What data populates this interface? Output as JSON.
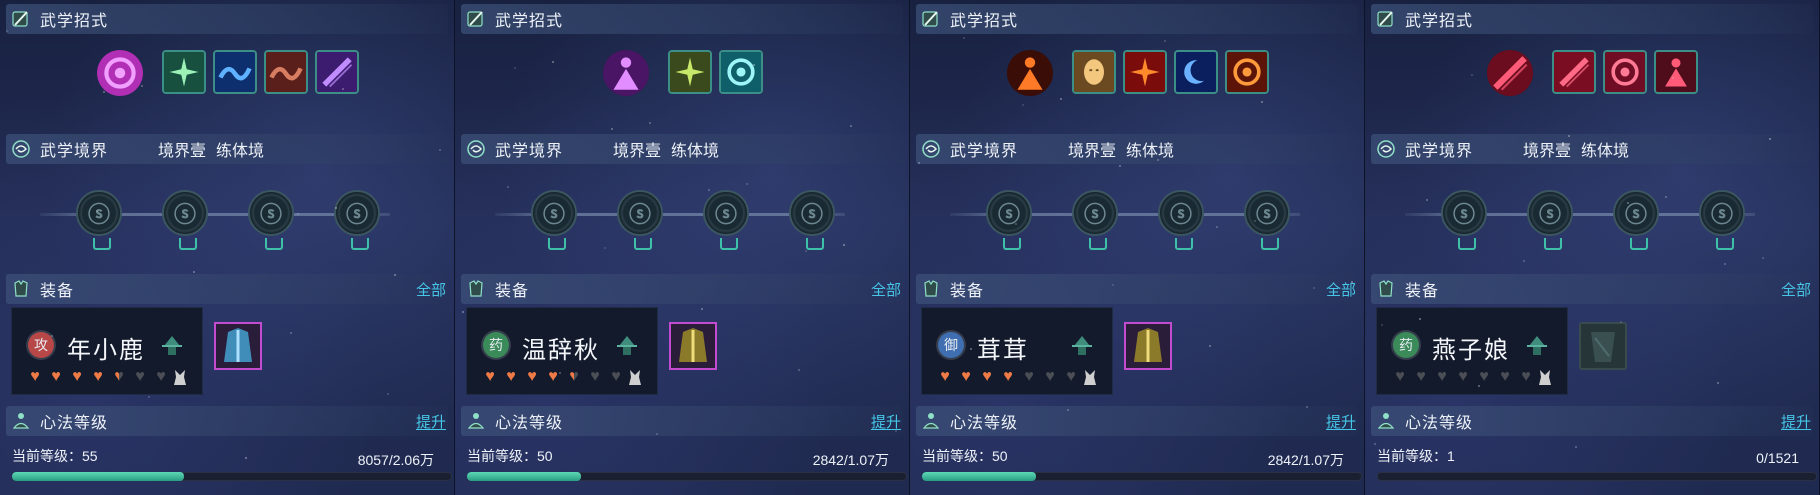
{
  "sections": {
    "moves_title": "武学招式",
    "realm_title": "武学境界",
    "equip_title": "装备",
    "equip_all": "全部",
    "xinfa_title": "心法等级",
    "xinfa_upgrade": "提升",
    "current_level_label": "当前等级："
  },
  "panels": [
    {
      "realm_level": "境界壹",
      "realm_name": "练体境",
      "character": {
        "badge": "攻",
        "badge_color": "#b84848",
        "name": "年小鹿",
        "stars": [
          1,
          1,
          1,
          1,
          0.5,
          0,
          0
        ]
      },
      "gear": "robe-blue",
      "level": "55",
      "exp": "8057/2.06万",
      "progress": 0.39,
      "skills": [
        "purple-vortex",
        "green-burst",
        "blue-serpent",
        "red-dragon",
        "violet-slash"
      ]
    },
    {
      "realm_level": "境界壹",
      "realm_name": "练体境",
      "character": {
        "badge": "药",
        "badge_color": "#3b8a5a",
        "name": "温辞秋",
        "stars": [
          1,
          1,
          1,
          1,
          0.5,
          0,
          0
        ]
      },
      "gear": "robe-gold",
      "level": "50",
      "exp": "2842/1.07万",
      "progress": 0.26,
      "skills": [
        "violet-figure",
        "green-light",
        "cyan-spiral"
      ]
    },
    {
      "realm_level": "境界壹",
      "realm_name": "练体境",
      "character": {
        "badge": "御",
        "badge_color": "#3f6fb0",
        "name": "茸茸",
        "stars": [
          1,
          1,
          1,
          1,
          0,
          0,
          0
        ]
      },
      "gear": "robe-gold",
      "level": "50",
      "exp": "2842/1.07万",
      "progress": 0.26,
      "skills": [
        "fire-figure",
        "golden-face",
        "red-explosion",
        "blue-moon",
        "flame-swirl"
      ]
    },
    {
      "realm_level": "境界壹",
      "realm_name": "练体境",
      "character": {
        "badge": "药",
        "badge_color": "#3b8a5a",
        "name": "燕子娘",
        "stars": [
          0,
          0,
          0,
          0,
          0,
          0,
          0
        ]
      },
      "gear": "empty",
      "level": "1",
      "exp": "0/1521",
      "progress": 0.0,
      "skills": [
        "crimson-slash",
        "crimson-slash-2",
        "crimson-swirl",
        "crimson-figure"
      ]
    }
  ]
}
